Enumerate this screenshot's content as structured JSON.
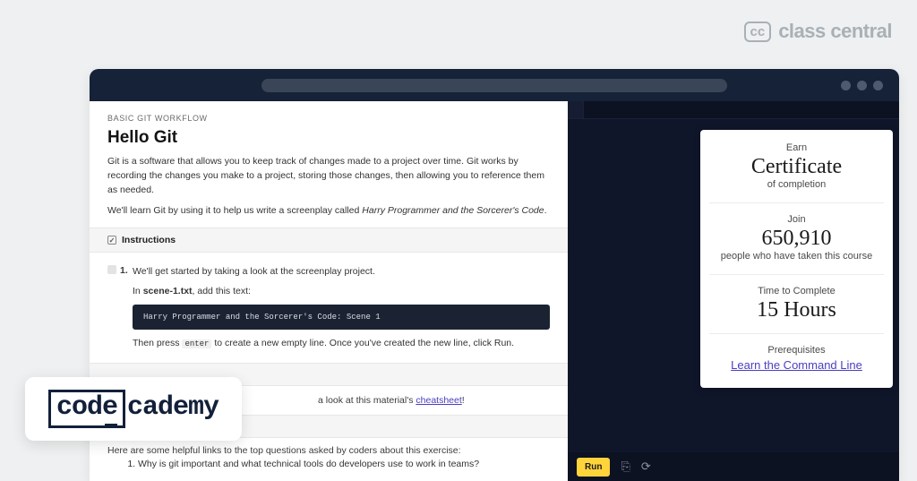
{
  "brand": {
    "cc_short": "cc",
    "cc_name": "class central"
  },
  "provider": {
    "boxed": "code",
    "rest": "cademy"
  },
  "lesson": {
    "eyebrow": "BASIC GIT WORKFLOW",
    "title": "Hello Git",
    "p1": "Git is a software that allows you to keep track of changes made to a project over time. Git works by recording the changes you make to a project, storing those changes, then allowing you to reference them as needed.",
    "p2_a": "We'll learn Git by using it to help us write a screenplay called ",
    "p2_em": "Harry Programmer and the Sorcerer's Code",
    "p2_b": ".",
    "instructions_label": "Instructions",
    "step1": {
      "num": "1.",
      "line1": "We'll get started by taking a look at the screenplay project.",
      "line2_a": "In ",
      "line2_file": "scene-1.txt",
      "line2_b": ", add this text:",
      "code": "Harry Programmer and the Sorcerer's Code: Scene 1",
      "line3_a": "Then press ",
      "line3_kbd": "enter",
      "line3_b": " to create a new empty line. Once you've created the new line, click Run."
    },
    "cheat_a": "a look at this material's ",
    "cheat_link": "cheatsheet",
    "cheat_b": "!",
    "faq_intro": "Here are some helpful links to the top questions asked by coders about this exercise:",
    "faq_1": "Why is git important and what technical tools do developers use to work in teams?"
  },
  "stats": {
    "earn": "Earn",
    "cert": "Certificate",
    "of": "of completion",
    "join": "Join",
    "count": "650,910",
    "people": "people who have taken this course",
    "ttc": "Time to Complete",
    "hours": "15 Hours",
    "prereq": "Prerequisites",
    "prereq_link": "Learn the Command Line"
  },
  "toolbar": {
    "run": "Run"
  }
}
